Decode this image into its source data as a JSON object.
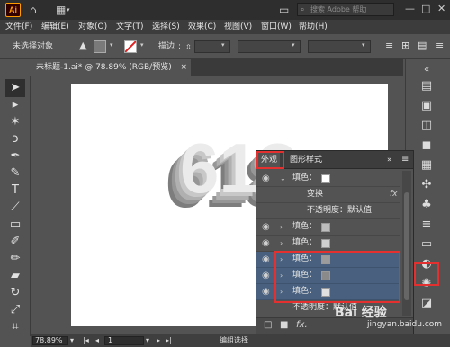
{
  "app": {
    "logo": "Ai",
    "search_placeholder": "搜索 Adobe 帮助"
  },
  "menu": [
    "文件(F)",
    "编辑(E)",
    "对象(O)",
    "文字(T)",
    "选择(S)",
    "效果(C)",
    "视图(V)",
    "窗口(W)",
    "帮助(H)"
  ],
  "control": {
    "selection_status": "未选择对象",
    "stroke_label": "描边",
    "stroke_sep": ":"
  },
  "document": {
    "tab_title": "未标题-1.ai* @ 78.89% (RGB/预览)",
    "close": "×"
  },
  "artwork": {
    "text": "618",
    "layers": [
      "#7d7d7d",
      "#969696",
      "#b0b0b0",
      "#c8c8c8",
      "#ebebeb"
    ]
  },
  "appearance": {
    "tabs": [
      "外观",
      "图形样式"
    ],
    "rows": [
      {
        "label": "填色：",
        "swatch": "#ffffff",
        "arrow": "⌄",
        "selected": false
      },
      {
        "label": "变换",
        "fx": "fx",
        "selected": false
      },
      {
        "label": "不透明度：默认值",
        "selected": false
      },
      {
        "label": "填色：",
        "swatch": "#bdbdbd",
        "arrow": "›",
        "selected": false
      },
      {
        "label": "填色：",
        "swatch": "#d0d0d0",
        "arrow": "›",
        "selected": false
      },
      {
        "label": "填色：",
        "swatch": "#9c9c9c",
        "arrow": "›",
        "selected": true
      },
      {
        "label": "填色：",
        "swatch": "#8a8a8a",
        "arrow": "›",
        "selected": true
      },
      {
        "label": "填色：",
        "swatch": "#e0e0e0",
        "arrow": "›",
        "selected": true
      },
      {
        "label": "不透明度：默认值",
        "selected": false
      }
    ],
    "bottom_icons": [
      "□",
      "■",
      "fx."
    ]
  },
  "status": {
    "zoom": "78.89%",
    "page": "1",
    "tool": "编组选择"
  },
  "watermark": {
    "brand": "Bai 经验",
    "url": "jingyan.baidu.com"
  },
  "colors": {
    "highlight": "#e53030",
    "selection": "#49617f",
    "logo_orange": "#ff9a00"
  }
}
